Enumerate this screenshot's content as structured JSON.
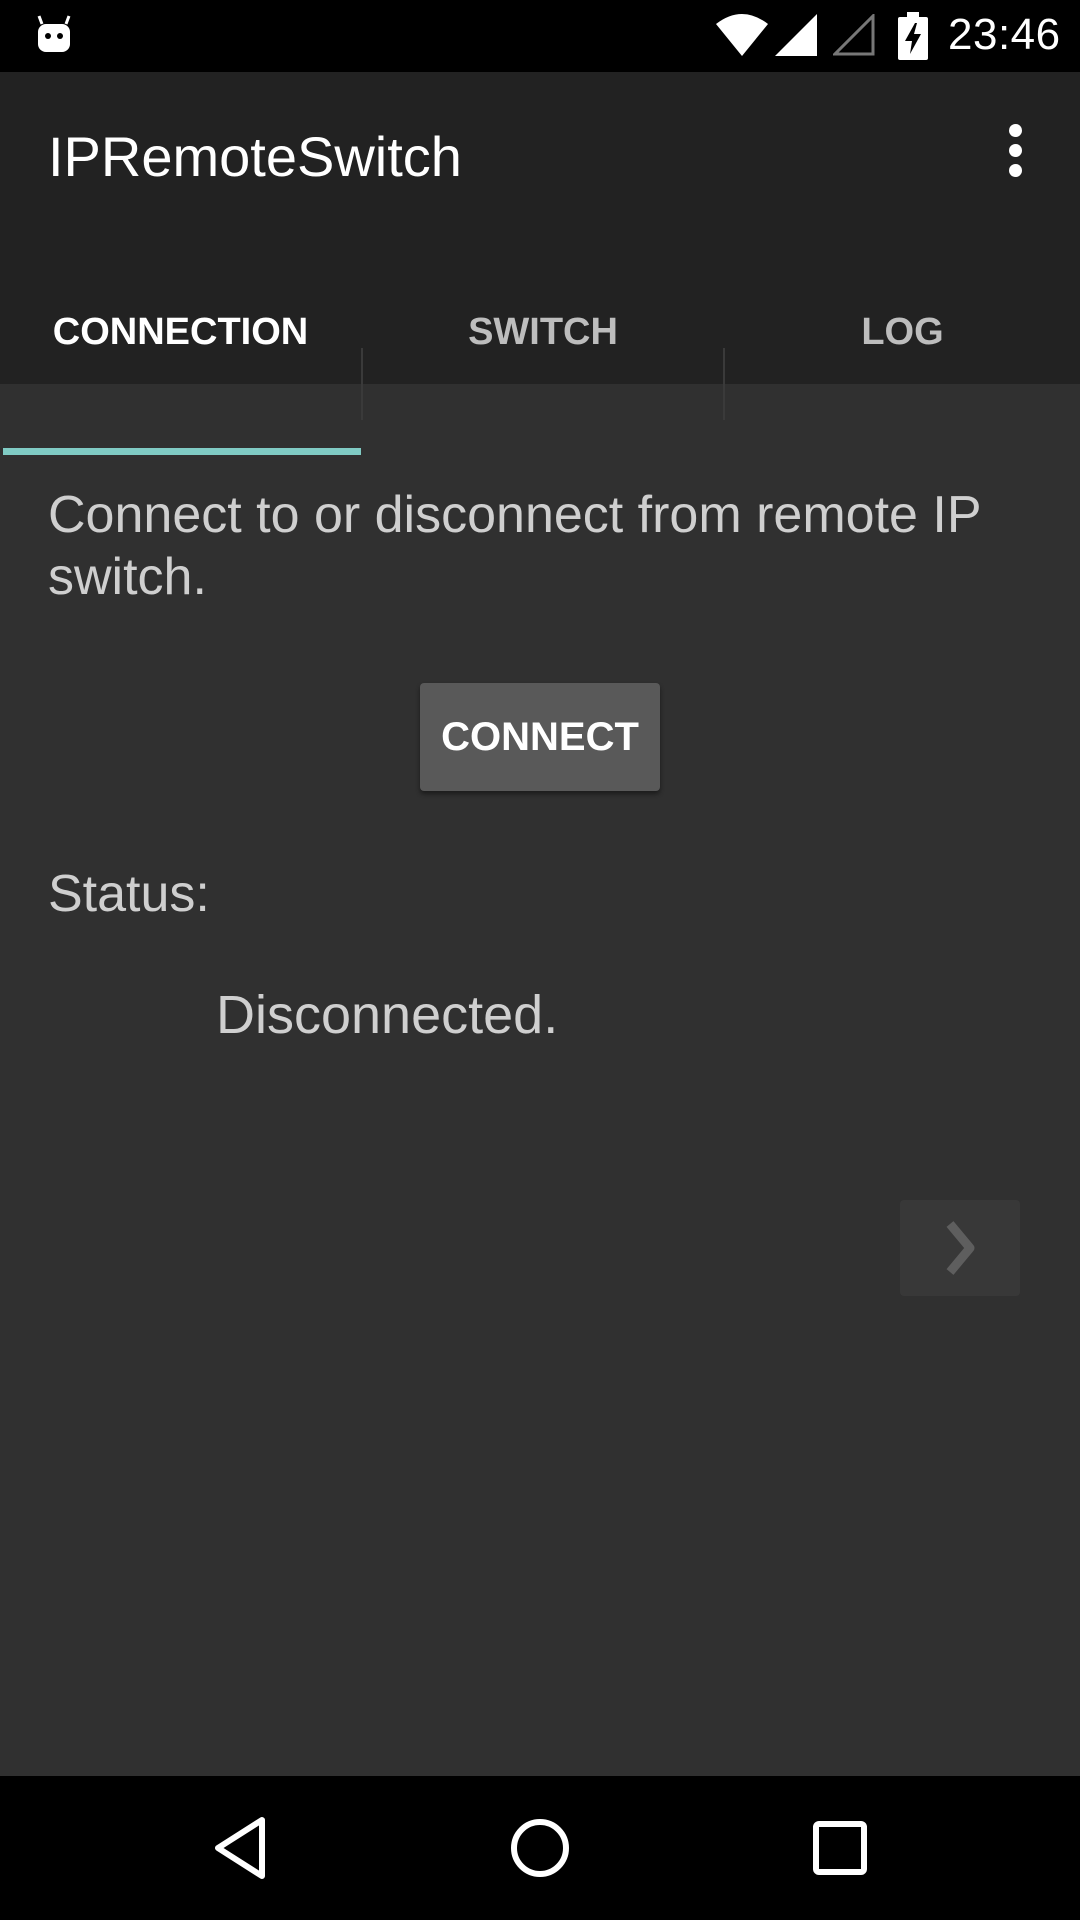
{
  "status_bar": {
    "time": "23:46",
    "icons": [
      "android-notification-icon",
      "wifi-icon",
      "cell-signal-icon",
      "cell-signal-empty-icon",
      "battery-charging-icon"
    ]
  },
  "app_bar": {
    "title": "IPRemoteSwitch",
    "overflow_icon": "more-vert-icon"
  },
  "tabs": [
    {
      "label": "CONNECTION",
      "active": true
    },
    {
      "label": "SWITCH",
      "active": false
    },
    {
      "label": "LOG",
      "active": false
    }
  ],
  "content": {
    "description": "Connect to or disconnect from remote IP switch.",
    "connect_button": "CONNECT",
    "status_label": "Status:",
    "status_value": "Disconnected.",
    "next_icon": "chevron-right-icon"
  },
  "nav_bar": {
    "icons": [
      "back-icon",
      "home-icon",
      "recents-icon"
    ]
  },
  "colors": {
    "background": "#303030",
    "app_bar": "#222222",
    "tab_indicator": "#80cbc4",
    "button": "#595959"
  }
}
